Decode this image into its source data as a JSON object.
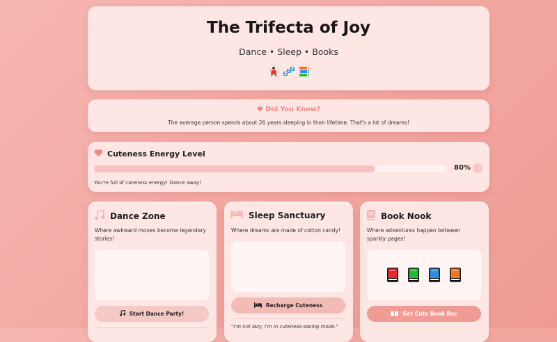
{
  "header": {
    "title": "The Trifecta of Joy",
    "subtitle": "Dance • Sleep • Books",
    "emojis": [
      "dancer-icon",
      "zzz-icon",
      "books-icon"
    ]
  },
  "fact": {
    "title": "Did You Know?",
    "text": "The average person spends about 26 years sleeping in their lifetime. That's a lot of dreams!"
  },
  "energy": {
    "title": "Cuteness Energy Level",
    "percent_label": "80%",
    "level": 0.8,
    "message": "You're full of cuteness energy! Dance away!"
  },
  "dance": {
    "title": "Dance Zone",
    "description": "Where awkward moves become legendary stories!",
    "button": "Start Dance Party!"
  },
  "sleep": {
    "title": "Sleep Sanctuary",
    "description": "Where dreams are made of cotton candy!",
    "button": "Recharge Cuteness",
    "quote": "\"I'm not lazy, I'm in cuteness-saving mode.\""
  },
  "books": {
    "title": "Book Nook",
    "description": "Where adventures happen between sparkly pages!",
    "button": "Get Cute Book Rec",
    "book_colors": [
      "#e8262e",
      "#27b93a",
      "#2f8ee0",
      "#f07a22"
    ]
  },
  "colors": {
    "accent": "#ee8a84",
    "card": "#fde6e4",
    "background": "#f3a8a2"
  }
}
